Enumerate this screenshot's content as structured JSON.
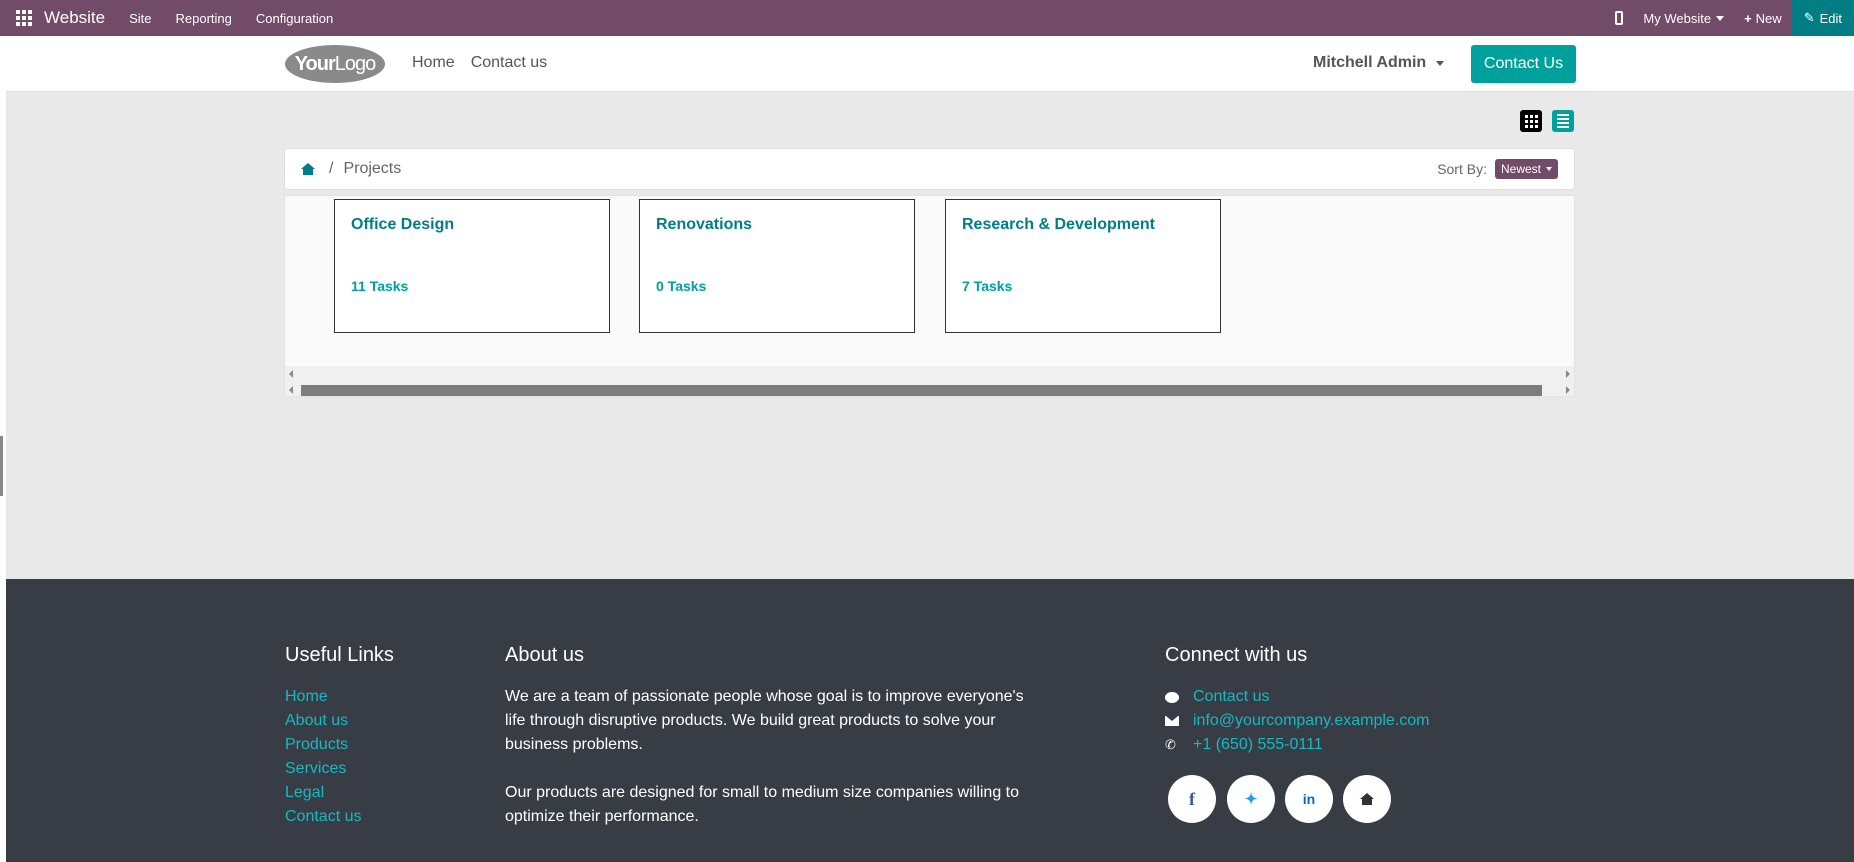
{
  "topbar": {
    "app_name": "Website",
    "menus": [
      "Site",
      "Reporting",
      "Configuration"
    ],
    "website_selector": "My Website",
    "new_label": "New",
    "edit_label": "Edit"
  },
  "header": {
    "logo_text_bold": "Your",
    "logo_text_thin": "Logo",
    "nav": [
      "Home",
      "Contact us"
    ],
    "user": "Mitchell Admin",
    "contact_button": "Contact Us"
  },
  "breadcrumb": {
    "current": "Projects",
    "separator": "/"
  },
  "sort": {
    "label": "Sort By:",
    "value": "Newest"
  },
  "projects": [
    {
      "name": "Office Design",
      "tasks": "11 Tasks"
    },
    {
      "name": "Renovations",
      "tasks": "0 Tasks"
    },
    {
      "name": "Research & Development",
      "tasks": "7 Tasks"
    }
  ],
  "footer": {
    "useful_links_title": "Useful Links",
    "useful_links": [
      "Home",
      "About us",
      "Products",
      "Services",
      "Legal",
      "Contact us"
    ],
    "about_title": "About us",
    "about_p1": "We are a team of passionate people whose goal is to improve everyone's life through disruptive products. We build great products to solve your business problems.",
    "about_p2": "Our products are designed for small to medium size companies willing to optimize their performance.",
    "connect_title": "Connect with us",
    "connect": {
      "contact": "Contact us",
      "email": "info@yourcompany.example.com",
      "phone": "+1 (650) 555-0111"
    },
    "social": [
      "facebook-icon",
      "twitter-icon",
      "linkedin-icon",
      "home-icon"
    ]
  },
  "colors": {
    "topbar": "#714b67",
    "primary": "#00a09d",
    "link": "#017e84",
    "footer_bg": "#373c45"
  }
}
